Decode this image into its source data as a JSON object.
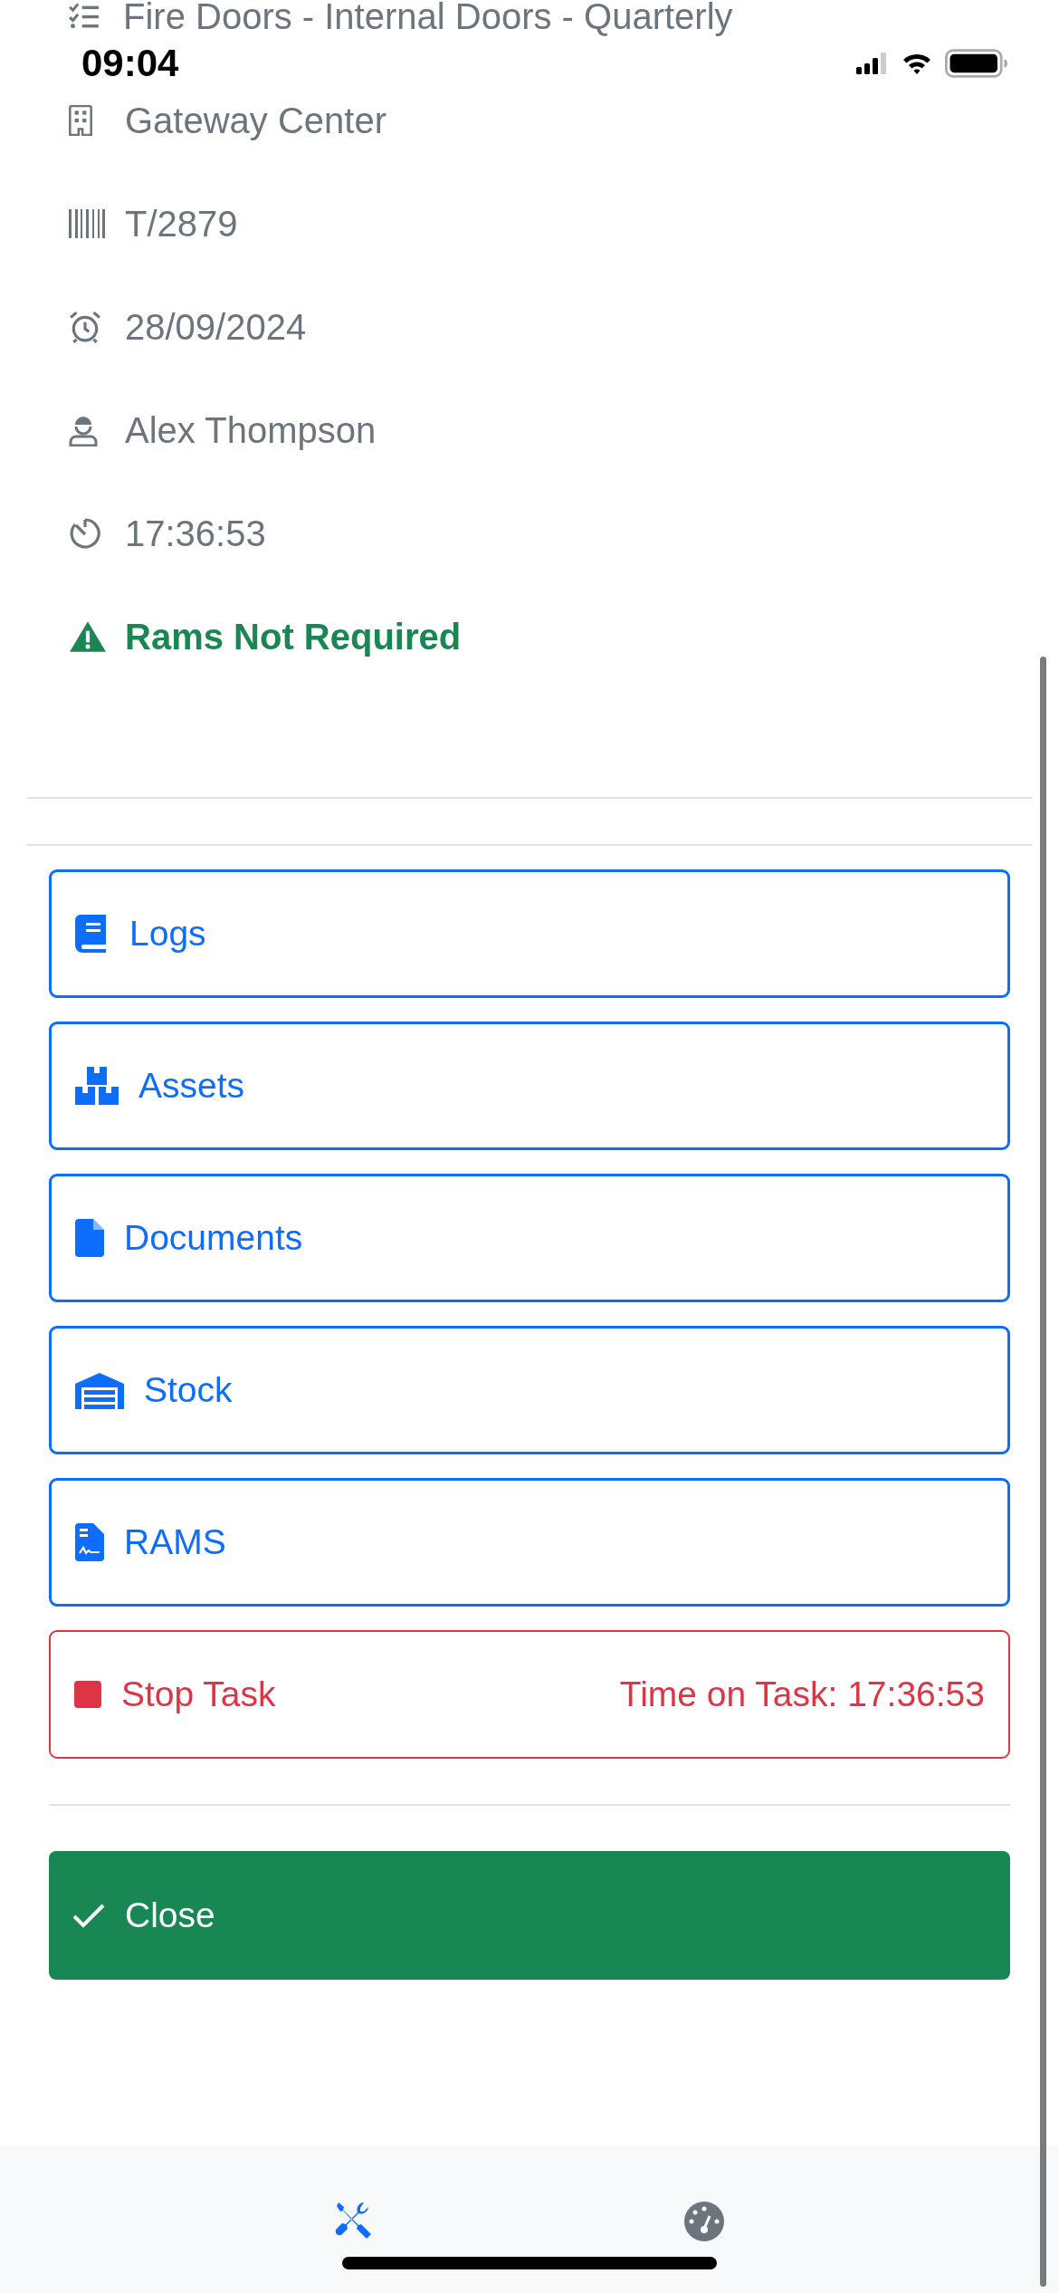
{
  "task": {
    "title": "Fire Doors - Internal Doors - Quarterly"
  },
  "status_bar": {
    "time": "09:04"
  },
  "details": [
    {
      "kind": "site",
      "text": "Gateway Center"
    },
    {
      "kind": "reference",
      "text": "T/2879"
    },
    {
      "kind": "due",
      "text": "28/09/2024"
    },
    {
      "kind": "engineer",
      "text": "Alex Thompson"
    },
    {
      "kind": "timer",
      "text": "17:36:53"
    }
  ],
  "rams_notice": {
    "text": "Rams Not Required"
  },
  "actions": [
    {
      "kind": "logs",
      "label": "Logs"
    },
    {
      "kind": "assets",
      "label": "Assets"
    },
    {
      "kind": "documents",
      "label": "Documents"
    },
    {
      "kind": "stock",
      "label": "Stock"
    },
    {
      "kind": "rams",
      "label": "RAMS"
    }
  ],
  "stop_task": {
    "label": "Stop Task",
    "time_label": "Time on Task: 17:36:53"
  },
  "close_button": {
    "label": "Close"
  },
  "tab_bar": [
    {
      "kind": "tools",
      "selected": true
    },
    {
      "kind": "dashboard",
      "selected": false
    }
  ]
}
